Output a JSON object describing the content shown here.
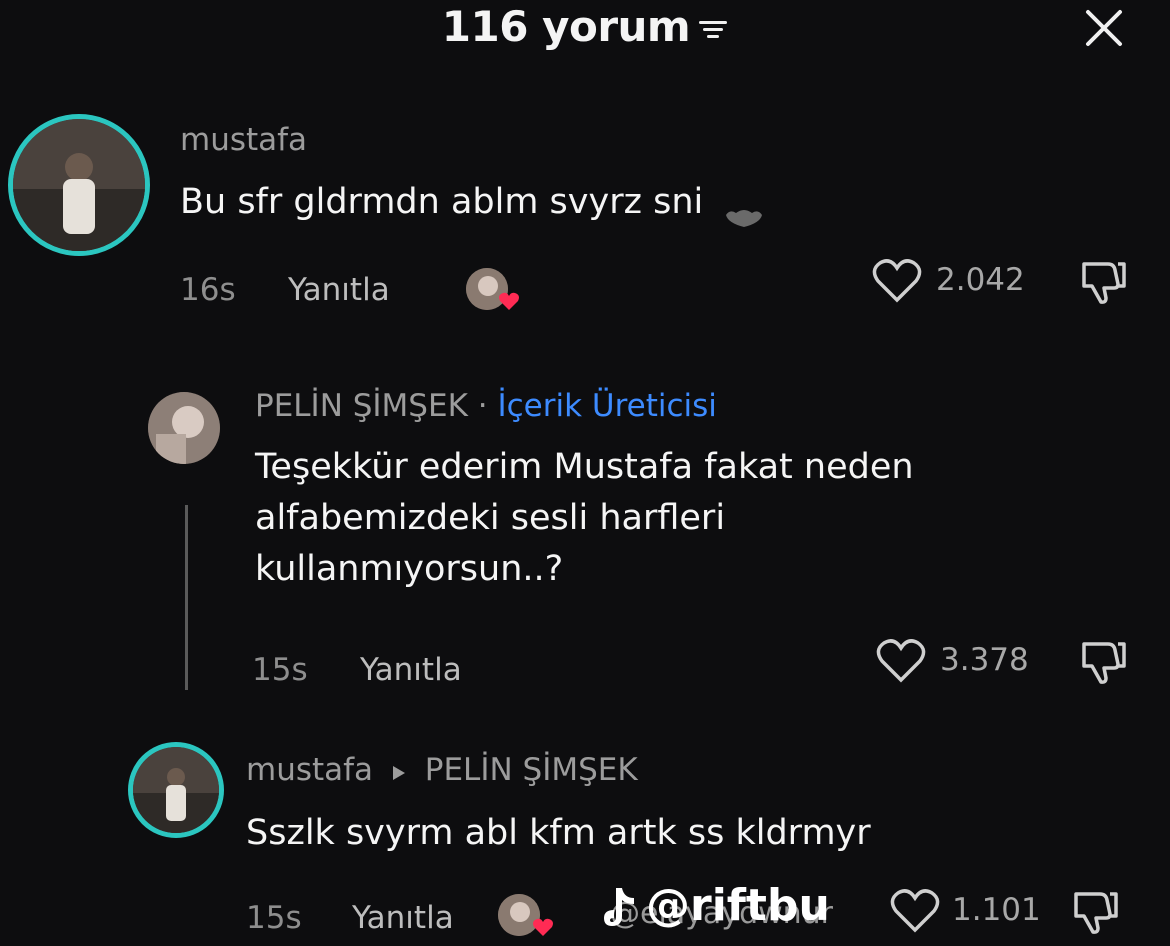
{
  "header": {
    "title": "116 yorum"
  },
  "comments": [
    {
      "username": "mustafa",
      "text": "Bu sfr gldrmdn ablm svyrz sni",
      "time": "16s",
      "reply_label": "Yanıtla",
      "likes": "2.042"
    },
    {
      "username": "PELİN ŞİMŞEK",
      "separator": "·",
      "role": "İçerik Üreticisi",
      "text_lines": [
        "Teşekkür ederim Mustafa fakat neden",
        "alfabemizdeki sesli harfleri",
        "kullanmıyorsun..?"
      ],
      "time": "15s",
      "reply_label": "Yanıtla",
      "likes": "3.378"
    },
    {
      "username": "mustafa",
      "reply_to": "PELİN ŞİMŞEK",
      "text": "Sszlk svyrm abl kfm artk ss kldrmyr",
      "time": "15s",
      "reply_label": "Yanıtla",
      "likes": "1.101"
    }
  ],
  "watermark": {
    "brand": "@riftbu",
    "handle": "@elayaydwnur"
  },
  "colors": {
    "accent": "#2bc6c0",
    "creator_badge": "#3d8bff"
  }
}
